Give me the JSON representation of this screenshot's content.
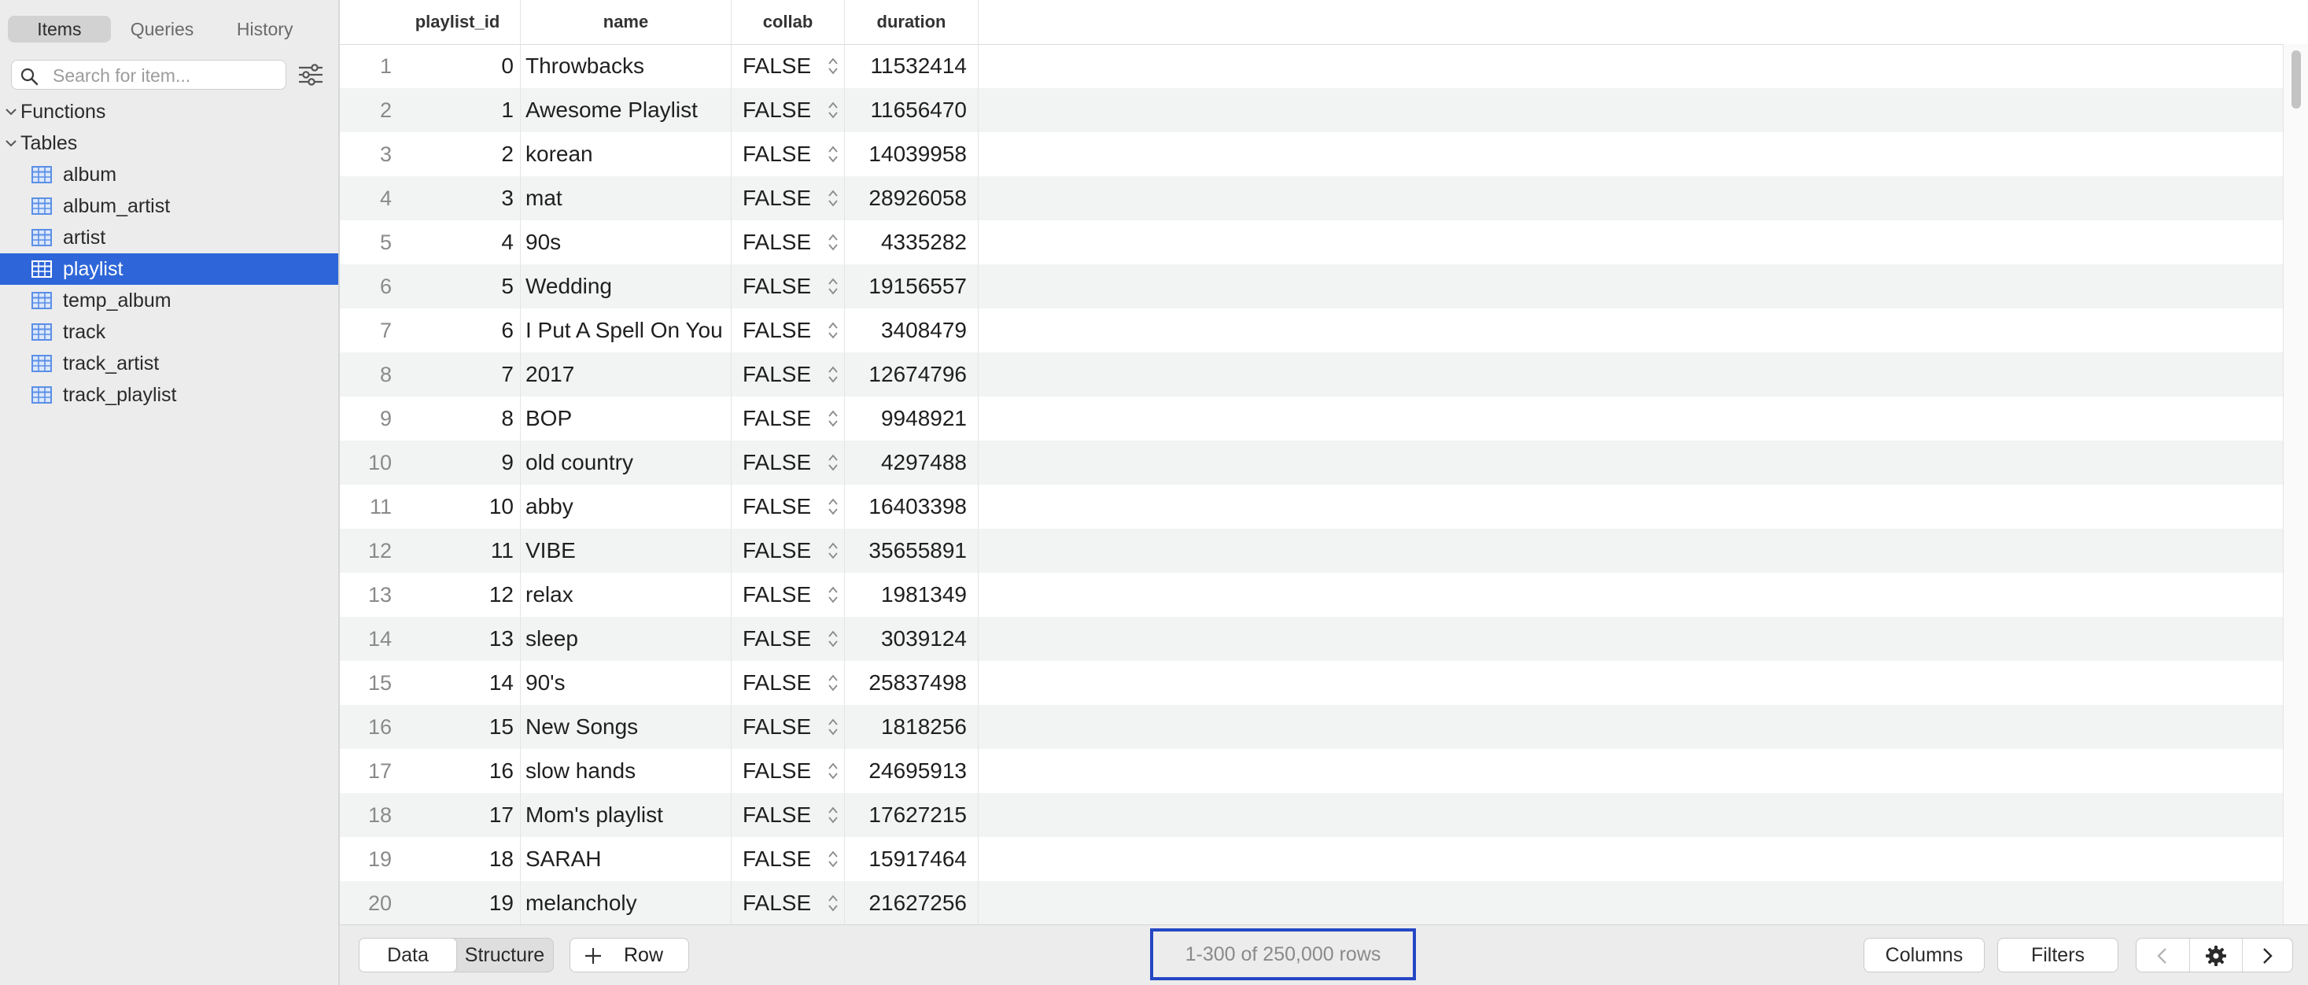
{
  "sidebar": {
    "tabs": [
      {
        "label": "Items",
        "active": true
      },
      {
        "label": "Queries",
        "active": false
      },
      {
        "label": "History",
        "active": false
      }
    ],
    "search_placeholder": "Search for item...",
    "groups": {
      "functions": "Functions",
      "tables": "Tables"
    },
    "tables": [
      "album",
      "album_artist",
      "artist",
      "playlist",
      "temp_album",
      "track",
      "track_artist",
      "track_playlist"
    ],
    "selected_table": "playlist",
    "accent_color": "#2e66d9"
  },
  "grid": {
    "columns": [
      "playlist_id",
      "name",
      "collab",
      "duration"
    ],
    "rows": [
      {
        "num": "1",
        "playlist_id": "0",
        "name": "Throwbacks",
        "collab": "FALSE",
        "duration": "11532414"
      },
      {
        "num": "2",
        "playlist_id": "1",
        "name": "Awesome Playlist",
        "collab": "FALSE",
        "duration": "11656470"
      },
      {
        "num": "3",
        "playlist_id": "2",
        "name": "korean",
        "collab": "FALSE",
        "duration": "14039958"
      },
      {
        "num": "4",
        "playlist_id": "3",
        "name": "mat",
        "collab": "FALSE",
        "duration": "28926058"
      },
      {
        "num": "5",
        "playlist_id": "4",
        "name": "90s",
        "collab": "FALSE",
        "duration": "4335282"
      },
      {
        "num": "6",
        "playlist_id": "5",
        "name": "Wedding",
        "collab": "FALSE",
        "duration": "19156557"
      },
      {
        "num": "7",
        "playlist_id": "6",
        "name": "I Put A Spell On You",
        "collab": "FALSE",
        "duration": "3408479"
      },
      {
        "num": "8",
        "playlist_id": "7",
        "name": "2017",
        "collab": "FALSE",
        "duration": "12674796"
      },
      {
        "num": "9",
        "playlist_id": "8",
        "name": "BOP",
        "collab": "FALSE",
        "duration": "9948921"
      },
      {
        "num": "10",
        "playlist_id": "9",
        "name": "old country",
        "collab": "FALSE",
        "duration": "4297488"
      },
      {
        "num": "11",
        "playlist_id": "10",
        "name": "abby",
        "collab": "FALSE",
        "duration": "16403398"
      },
      {
        "num": "12",
        "playlist_id": "11",
        "name": "VIBE",
        "collab": "FALSE",
        "duration": "35655891"
      },
      {
        "num": "13",
        "playlist_id": "12",
        "name": "relax",
        "collab": "FALSE",
        "duration": "1981349"
      },
      {
        "num": "14",
        "playlist_id": "13",
        "name": "sleep",
        "collab": "FALSE",
        "duration": "3039124"
      },
      {
        "num": "15",
        "playlist_id": "14",
        "name": "90's",
        "collab": "FALSE",
        "duration": "25837498"
      },
      {
        "num": "16",
        "playlist_id": "15",
        "name": "New Songs",
        "collab": "FALSE",
        "duration": "1818256"
      },
      {
        "num": "17",
        "playlist_id": "16",
        "name": "slow hands",
        "collab": "FALSE",
        "duration": "24695913"
      },
      {
        "num": "18",
        "playlist_id": "17",
        "name": "Mom's playlist",
        "collab": "FALSE",
        "duration": "17627215"
      },
      {
        "num": "19",
        "playlist_id": "18",
        "name": "SARAH",
        "collab": "FALSE",
        "duration": "15917464"
      },
      {
        "num": "20",
        "playlist_id": "19",
        "name": "melancholy",
        "collab": "FALSE",
        "duration": "21627256"
      }
    ]
  },
  "footer": {
    "tabs": [
      {
        "label": "Data",
        "active": true
      },
      {
        "label": "Structure",
        "active": false
      }
    ],
    "add_row_label": "Row",
    "rows_info": "1-300 of 250,000 rows",
    "columns_label": "Columns",
    "filters_label": "Filters",
    "highlight_color": "#2547c4"
  },
  "icons": {
    "search": "search-icon",
    "filter": "sliders-icon",
    "table": "table-icon",
    "chevron": "chevron-down-icon",
    "stepper": "up-down-stepper-icon",
    "plus": "plus-icon",
    "prev": "chevron-left-icon",
    "settings": "gear-icon",
    "next": "chevron-right-icon"
  }
}
